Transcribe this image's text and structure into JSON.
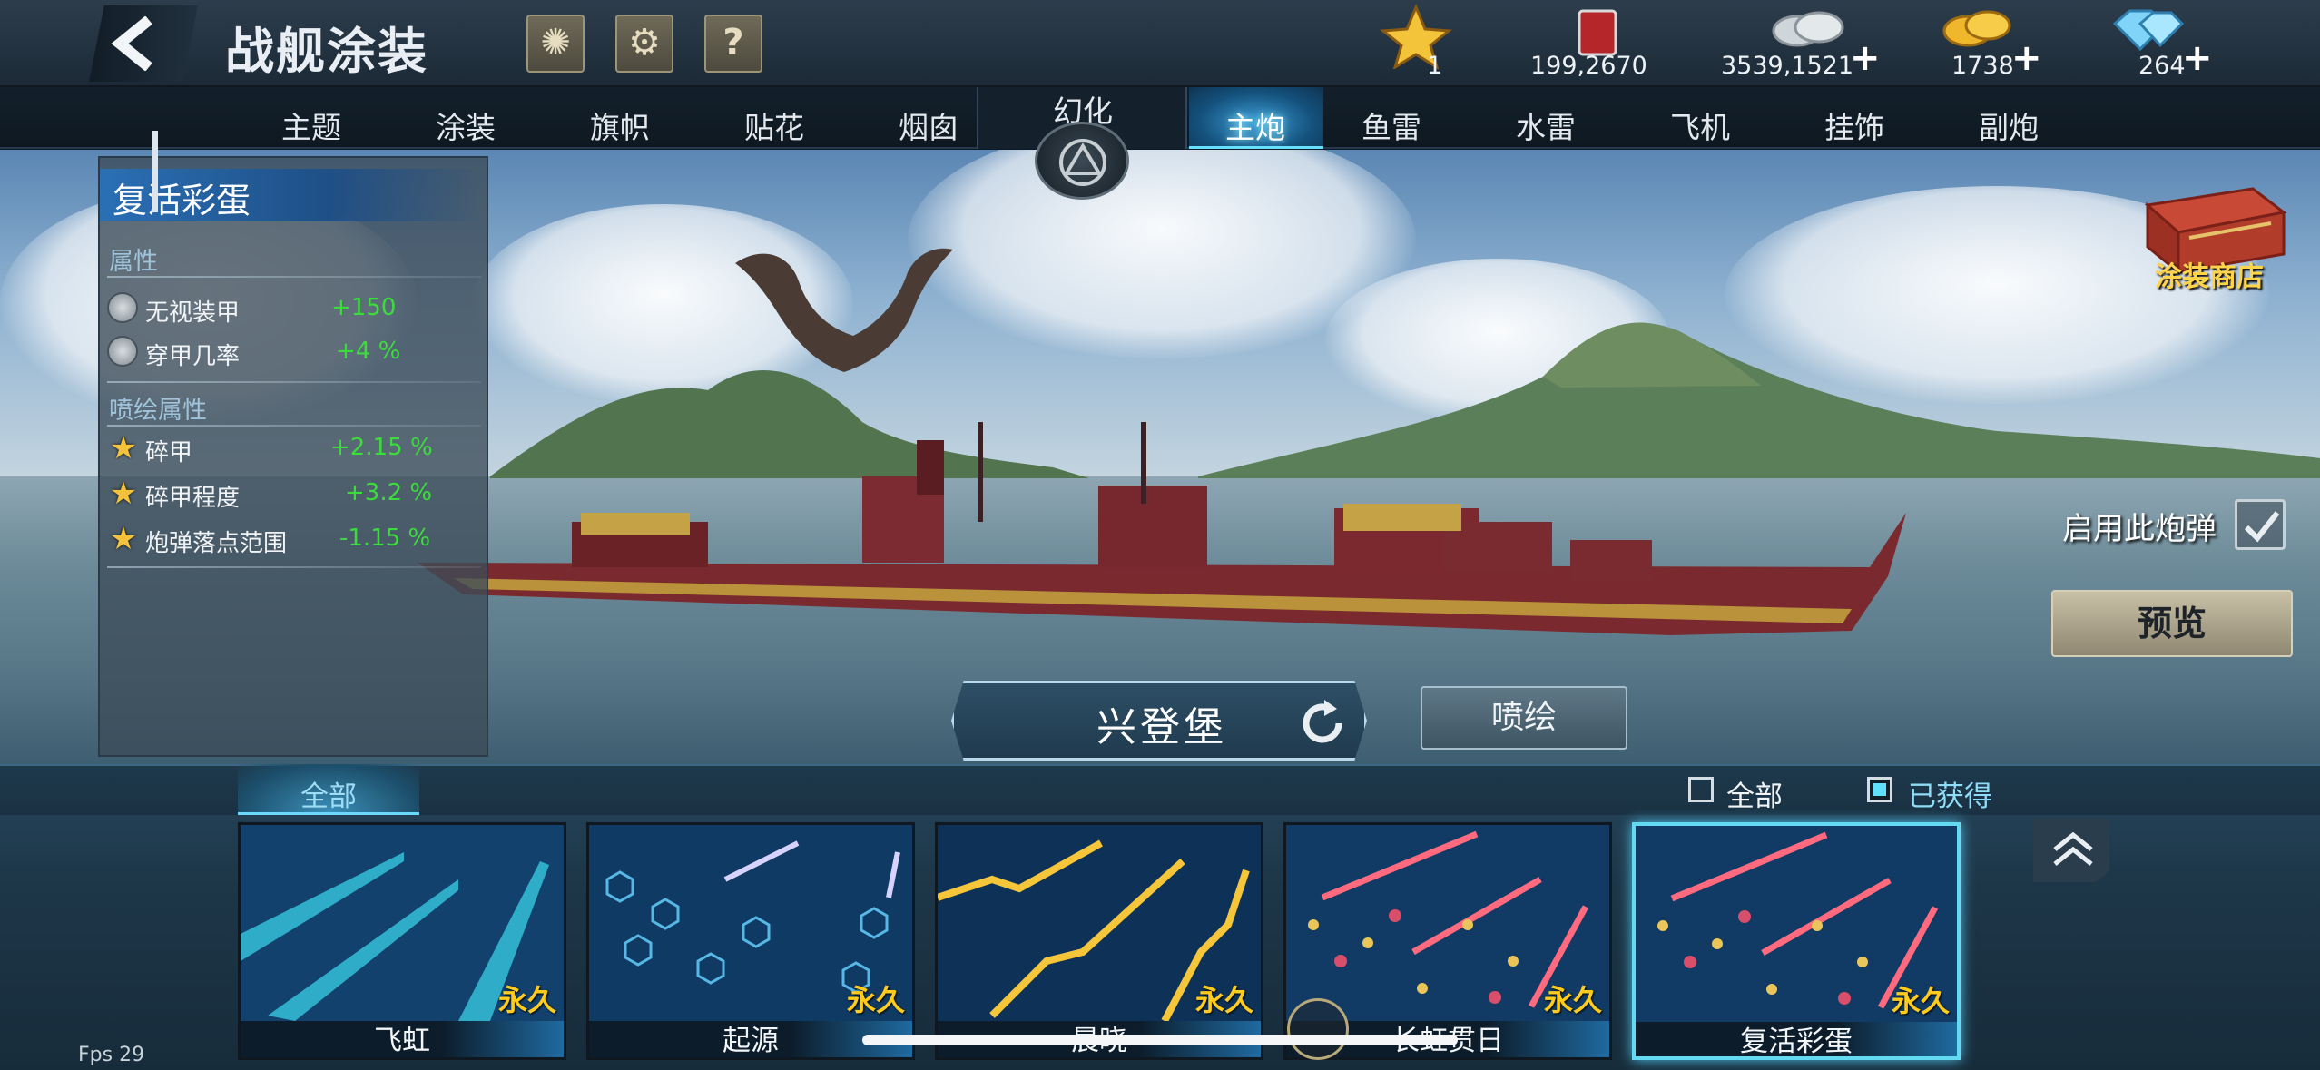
{
  "header": {
    "title": "战舰涂装",
    "help_label": "?"
  },
  "resources": {
    "stars": "1",
    "paint": "199,2670",
    "silver": "3539,1521",
    "gold": "1738",
    "diamond": "264"
  },
  "tabs": [
    "主题",
    "涂装",
    "旗帜",
    "贴花",
    "烟囱",
    "幻化",
    "主炮",
    "鱼雷",
    "水雷",
    "飞机",
    "挂饰",
    "副炮"
  ],
  "active_tab": "主炮",
  "panel": {
    "skin_name": "复活彩蛋",
    "section_attrs": "属性",
    "attrs": [
      {
        "label": "无视装甲",
        "value": "+150"
      },
      {
        "label": "穿甲几率",
        "value": "+4 %"
      }
    ],
    "section_spray": "喷绘属性",
    "spray_attrs": [
      {
        "label": "碎甲",
        "value": "+2.15 %"
      },
      {
        "label": "碎甲程度",
        "value": "+3.2 %"
      },
      {
        "label": "炮弹落点范围",
        "value": "-1.15 %"
      }
    ]
  },
  "shop": {
    "label": "涂装商店"
  },
  "use_shell": {
    "label": "启用此炮弹"
  },
  "preview": {
    "label": "预览"
  },
  "ship": {
    "name": "兴登堡"
  },
  "spray": {
    "label": "喷绘"
  },
  "filter": {
    "tab_all": "全部",
    "check_all": "全部",
    "check_owned": "已获得"
  },
  "cards": [
    {
      "name": "飞虹",
      "badge": "永久"
    },
    {
      "name": "起源",
      "badge": "永久"
    },
    {
      "name": "晨晓",
      "badge": "永久"
    },
    {
      "name": "长虹贯日",
      "badge": "永久"
    },
    {
      "name": "复活彩蛋",
      "badge": "永久"
    }
  ],
  "fps": "Fps 29",
  "colors": {
    "accent": "#63d9f2",
    "green_value": "#3bdc3b",
    "gold_badge": "#ffcc1c"
  }
}
